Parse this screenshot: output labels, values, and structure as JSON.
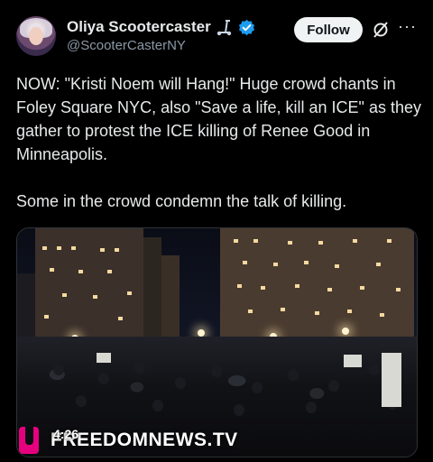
{
  "post": {
    "author": {
      "display_name": "Oliya Scootercaster",
      "handle": "@ScooterCasterNY",
      "emoji_icon": "scooter-icon",
      "verified_icon": "verified-badge-icon"
    },
    "follow_label": "Follow",
    "grok_icon": "grok-icon",
    "more_icon": "more-options-icon",
    "text": "NOW: \"Kristi Noem will Hang!\" Huge crowd chants in Foley Square NYC, also \"Save a life, kill an ICE\" as they gather to protest the ICE killing of Renee Good in Minneapolis.\n\nSome in the crowd condemn the talk of killing.",
    "media": {
      "duration": "4:26",
      "watermark": "FREEDOMNEWS.TV"
    }
  },
  "colors": {
    "background": "#000000",
    "text": "#e7e9ea",
    "secondary_text": "#8b98a5",
    "verified": "#1d9bf0",
    "follow_button_bg": "#eff3f4",
    "watermark_accent": "#e6007e"
  }
}
